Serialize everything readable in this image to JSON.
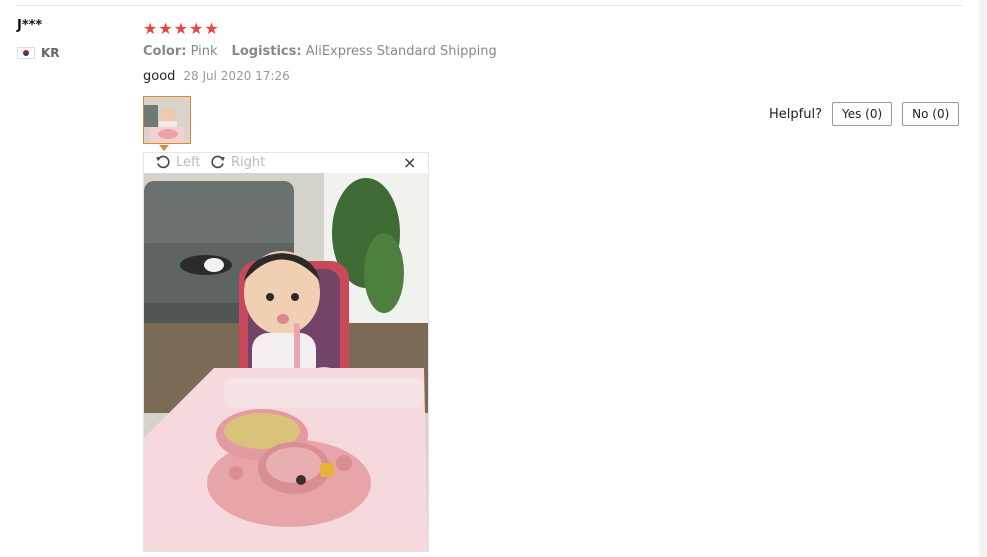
{
  "review": {
    "user_name": "J***",
    "country_code": "KR",
    "rating": 5,
    "color_label": "Color:",
    "color_value": "Pink",
    "logistics_label": "Logistics:",
    "logistics_value": "AliExpress Standard Shipping",
    "text": "good",
    "date": "28 Jul 2020 17:26"
  },
  "helpful": {
    "label": "Helpful?",
    "yes_label": "Yes (0)",
    "no_label": "No (0)"
  },
  "viewer": {
    "rotate_left_label": "Left",
    "rotate_right_label": "Right",
    "close_symbol": "×"
  },
  "colors": {
    "star": "#e64545",
    "thumb_border": "#e08a2f"
  }
}
